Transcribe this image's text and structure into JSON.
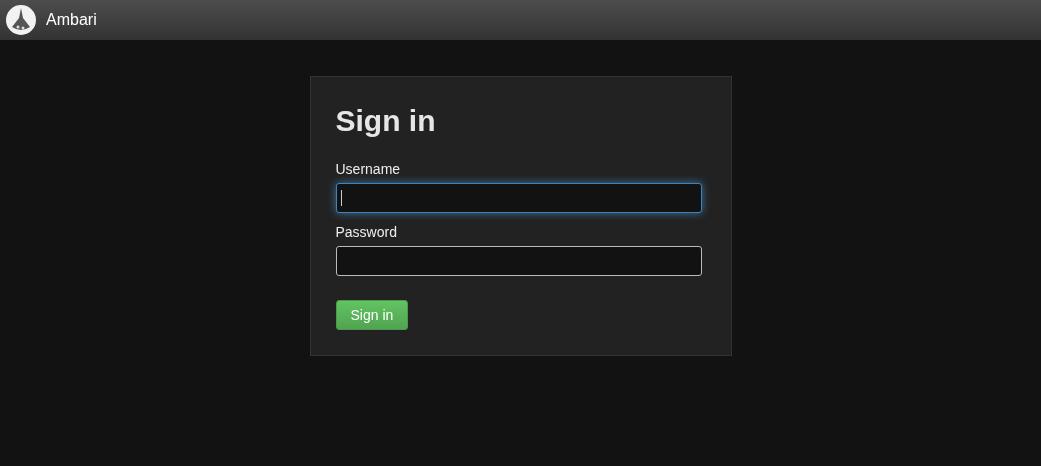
{
  "navbar": {
    "brand": "Ambari"
  },
  "form": {
    "title": "Sign in",
    "fields": [
      {
        "label": "Username",
        "focused": true
      },
      {
        "label": "Password",
        "focused": false
      }
    ],
    "submit": "Sign in"
  }
}
